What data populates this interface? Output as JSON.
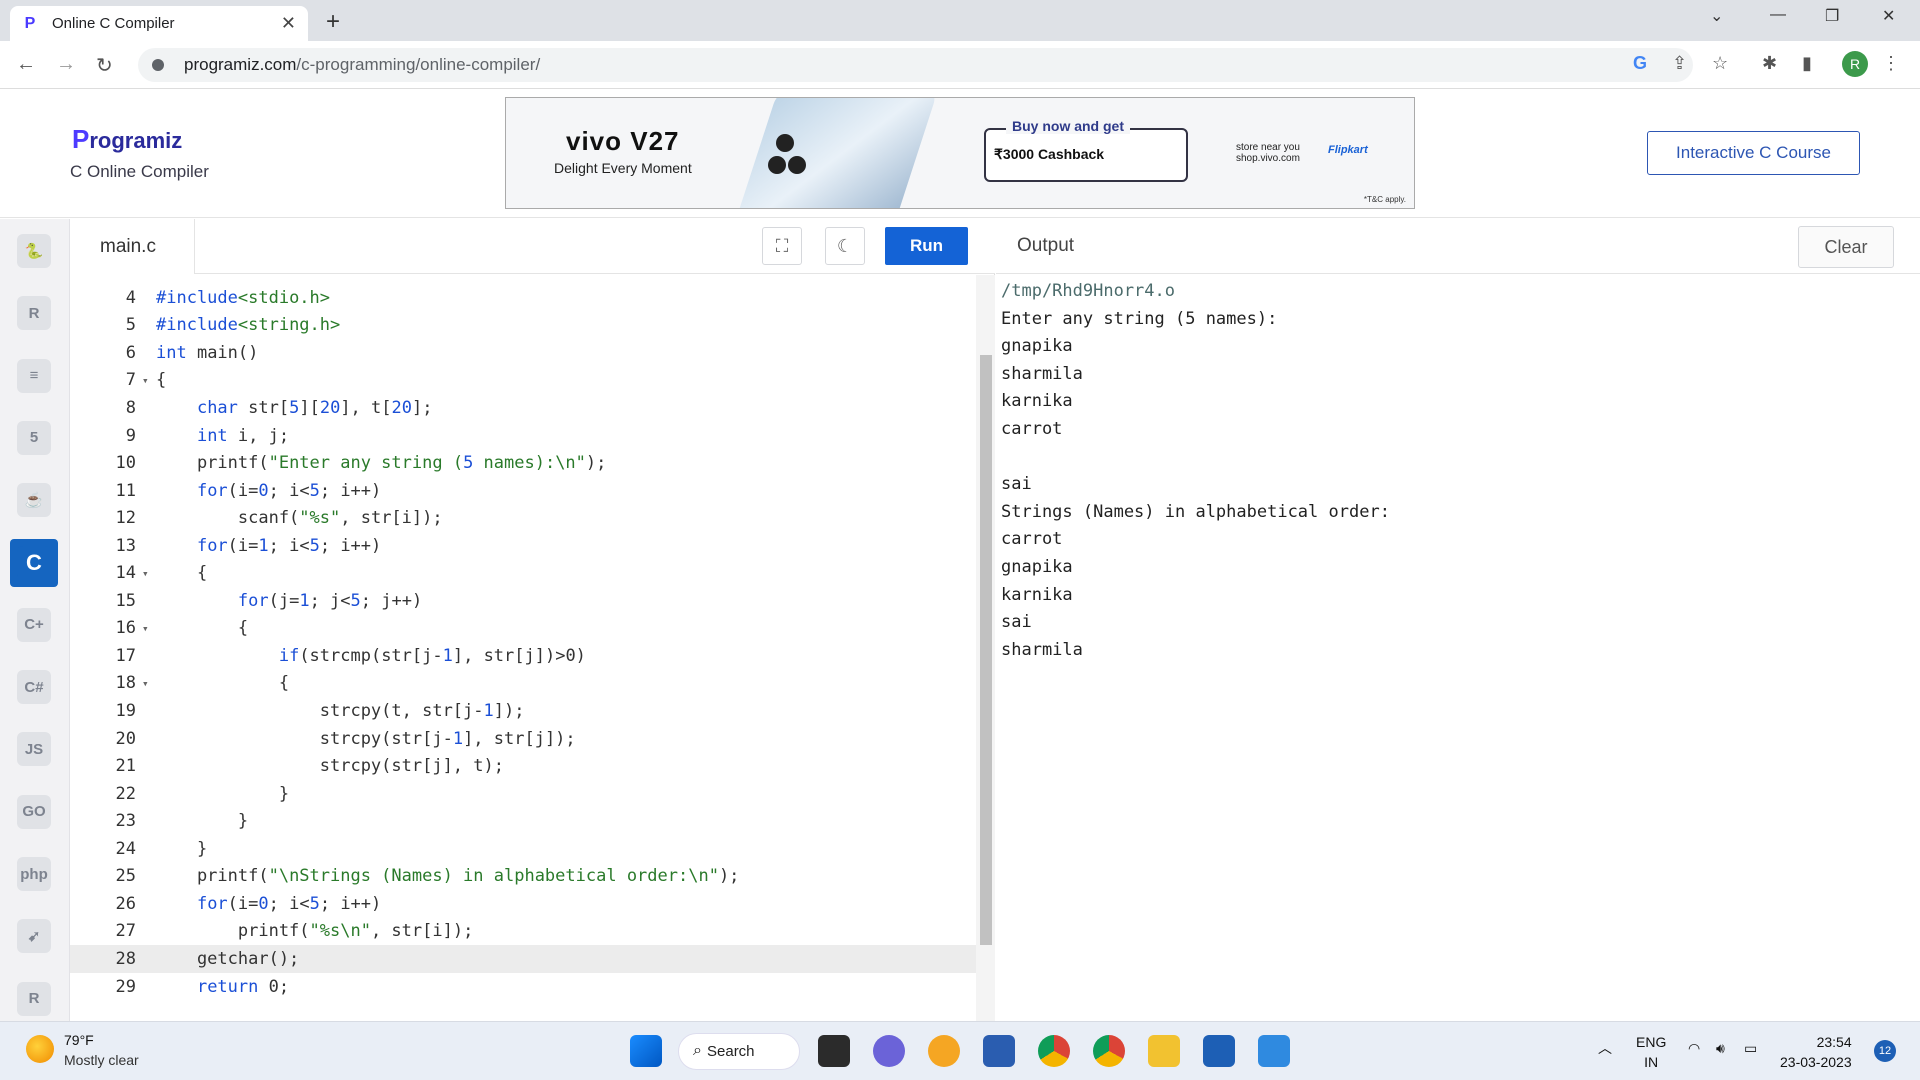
{
  "browser": {
    "tab_title": "Online C Compiler",
    "url_domain": "programiz.com",
    "url_path": "/c-programming/online-compiler/",
    "avatar_letter": "R"
  },
  "header": {
    "logo_text": "rogramiz",
    "logo_p": "P",
    "subtitle": "C Online Compiler",
    "course_button": "Interactive C Course"
  },
  "ad": {
    "brand": "vivo V27",
    "tagline": "Delight Every Moment",
    "offer_title": "Buy now and get",
    "offer_cash": "₹3000 Cashback",
    "store_line1": "store near you",
    "store_line2": "shop.vivo.com",
    "partner": "Flipkart",
    "tc": "*T&C apply."
  },
  "sidebar": {
    "languages": [
      {
        "name": "python",
        "glyph": "🐍"
      },
      {
        "name": "r",
        "glyph": "R"
      },
      {
        "name": "sql",
        "glyph": "≡"
      },
      {
        "name": "html",
        "glyph": "5"
      },
      {
        "name": "java",
        "glyph": "☕"
      },
      {
        "name": "c",
        "glyph": "C"
      },
      {
        "name": "cpp",
        "glyph": "C+"
      },
      {
        "name": "csharp",
        "glyph": "C#"
      },
      {
        "name": "js",
        "glyph": "JS"
      },
      {
        "name": "go",
        "glyph": "GO"
      },
      {
        "name": "php",
        "glyph": "php"
      },
      {
        "name": "swift",
        "glyph": "➹"
      },
      {
        "name": "rust",
        "glyph": "R"
      }
    ]
  },
  "editor": {
    "file_tab": "main.c",
    "run_label": "Run",
    "current_line": "28",
    "lines": [
      {
        "n": "4",
        "fold": "",
        "text": "#include<stdio.h>"
      },
      {
        "n": "5",
        "fold": "",
        "text": "#include<string.h>"
      },
      {
        "n": "6",
        "fold": "",
        "text": "int main()"
      },
      {
        "n": "7",
        "fold": "▾",
        "text": "{"
      },
      {
        "n": "8",
        "fold": "",
        "text": "    char str[5][20], t[20];"
      },
      {
        "n": "9",
        "fold": "",
        "text": "    int i, j;"
      },
      {
        "n": "10",
        "fold": "",
        "text": "    printf(\"Enter any string (5 names):\\n\");"
      },
      {
        "n": "11",
        "fold": "",
        "text": "    for(i=0; i<5; i++)"
      },
      {
        "n": "12",
        "fold": "",
        "text": "        scanf(\"%s\", str[i]);"
      },
      {
        "n": "13",
        "fold": "",
        "text": "    for(i=1; i<5; i++)"
      },
      {
        "n": "14",
        "fold": "▾",
        "text": "    {"
      },
      {
        "n": "15",
        "fold": "",
        "text": "        for(j=1; j<5; j++)"
      },
      {
        "n": "16",
        "fold": "▾",
        "text": "        {"
      },
      {
        "n": "17",
        "fold": "",
        "text": "            if(strcmp(str[j-1], str[j])>0)"
      },
      {
        "n": "18",
        "fold": "▾",
        "text": "            {"
      },
      {
        "n": "19",
        "fold": "",
        "text": "                strcpy(t, str[j-1]);"
      },
      {
        "n": "20",
        "fold": "",
        "text": "                strcpy(str[j-1], str[j]);"
      },
      {
        "n": "21",
        "fold": "",
        "text": "                strcpy(str[j], t);"
      },
      {
        "n": "22",
        "fold": "",
        "text": "            }"
      },
      {
        "n": "23",
        "fold": "",
        "text": "        }"
      },
      {
        "n": "24",
        "fold": "",
        "text": "    }"
      },
      {
        "n": "25",
        "fold": "",
        "text": "    printf(\"\\nStrings (Names) in alphabetical order:\\n\");"
      },
      {
        "n": "26",
        "fold": "",
        "text": "    for(i=0; i<5; i++)"
      },
      {
        "n": "27",
        "fold": "",
        "text": "        printf(\"%s\\n\", str[i]);"
      },
      {
        "n": "28",
        "fold": "",
        "text": "    getchar();"
      },
      {
        "n": "29",
        "fold": "",
        "text": "    return 0;"
      }
    ]
  },
  "output": {
    "title": "Output",
    "clear_label": "Clear",
    "lines": [
      "/tmp/Rhd9Hnorr4.o",
      "Enter any string (5 names):",
      "gnapika",
      "sharmila",
      "karnika",
      "carrot",
      "",
      "sai",
      "Strings (Names) in alphabetical order:",
      "carrot",
      "gnapika",
      "karnika",
      "sai",
      "sharmila"
    ]
  },
  "taskbar": {
    "temp": "79°F",
    "weather": "Mostly clear",
    "search_label": "Search",
    "lang_line1": "ENG",
    "lang_line2": "IN",
    "time": "23:54",
    "date": "23-03-2023",
    "notif_count": "12"
  },
  "colors": {
    "keyword": "#1b4fd6",
    "string": "#2a7a2a",
    "number": "#1b4fd6",
    "run": "#1463d6"
  }
}
